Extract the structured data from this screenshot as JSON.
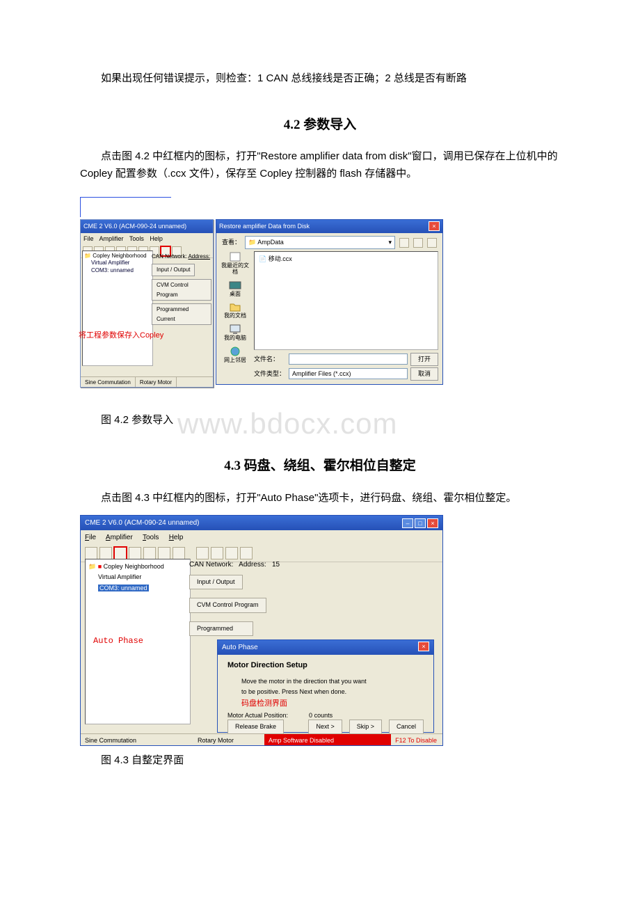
{
  "intro_line": "如果出现任何错误提示，则检查：1 CAN 总线接线是否正确；2 总线是否有断路",
  "sec42": {
    "heading": "4.2 参数导入",
    "para": "点击图 4.2 中红框内的图标，打开\"Restore amplifier data from disk\"窗口，调用已保存在上位机中的 Copley 配置参数（.ccx 文件），保存至 Copley 控制器的 flash 存储器中。",
    "caption": "图 4.2 参数导入"
  },
  "watermark": "www.bdocx.com",
  "cme": {
    "title": "CME 2 V6.0 (ACM-090-24 unnamed)",
    "menus": [
      "File",
      "Amplifier",
      "Tools",
      "Help"
    ],
    "tree": {
      "root": "Copley Neighborhood",
      "n1": "Virtual Amplifier",
      "n2": "COM3: unnamed"
    },
    "can_label": "CAN Network:",
    "addr_label": "Address:",
    "addr_value": "15",
    "btn_io": "Input / Output",
    "btn_cvm": "CVM Control Program",
    "btn_prog": "Programmed Current",
    "status_l": "Sine Commutation",
    "status_r": "Rotary Motor",
    "anno_save": "将工程参数保存入Copley",
    "anno_autophase": "Auto Phase"
  },
  "restore": {
    "title": "Restore amplifier Data from Disk",
    "look_in": "查看：",
    "folder": "AmpData",
    "file": "移动.ccx",
    "side": {
      "recent": "我最近的文档",
      "desktop": "桌面",
      "mydocs": "我的文档",
      "mypc": "我的电脑",
      "net": "网上邻居"
    },
    "filename_lbl": "文件名：",
    "filetype_lbl": "文件类型：",
    "filetype_val": "Amplifier Files (*.ccx)",
    "open": "打开",
    "cancel": "取消"
  },
  "sec43": {
    "heading": "4.3 码盘、绕组、霍尔相位自整定",
    "para": "点击图 4.3 中红框内的图标，打开\"Auto Phase\"选项卡，进行码盘、绕组、霍尔相位整定。",
    "caption": "图 4.3 自整定界面"
  },
  "autophase": {
    "title": "Auto Phase",
    "h": "Motor Direction Setup",
    "msg1": "Move the motor in the direction that you want",
    "msg2": "to be positive.  Press Next when done.",
    "anno_red": "码盘检测界面",
    "pos_lbl": "Motor Actual Position:",
    "pos_val": "0",
    "pos_unit": "counts",
    "b_release": "Release Brake",
    "b_next": "Next >",
    "b_skip": "Skip >",
    "b_cancel": "Cancel"
  },
  "status2": {
    "sine": "Sine Commutation",
    "rotary": "Rotary Motor",
    "warn": "Amp Software Disabled",
    "f12": "F12 To Disable"
  }
}
